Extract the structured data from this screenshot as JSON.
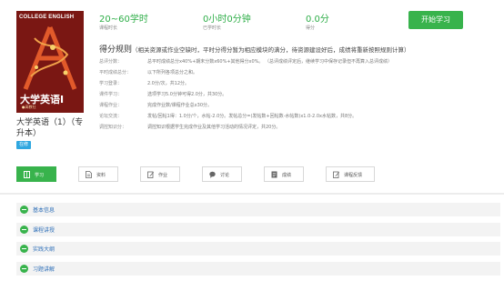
{
  "course": {
    "cover": {
      "caption": "COLLEGE ENGLISH",
      "title": "大学英语Ⅰ",
      "publisher": "●高教社"
    },
    "name": "大学英语（1）（专升本）",
    "badge": "在修"
  },
  "stats": [
    {
      "value": "20~60学时",
      "label": "课程时长"
    },
    {
      "value": "0小时0分钟",
      "label": "已学时长"
    },
    {
      "value": "0.0分",
      "label": "得分"
    }
  ],
  "start_button": "开始学习",
  "rules": {
    "title": "得分规则",
    "desc": "（相关资源或作业空缺时，平时分得分暂为相应模块的满分，待资源建设好后，成绩将重新按照规则计算）",
    "rows": [
      {
        "label": "总评分数：",
        "value": "总平时成绩总分x40%+期末分数x60%+其他得分x0%。  （总评成绩评定后，继续学习中保存记录但不再算入总评成绩）"
      },
      {
        "label": "平时成绩总分：",
        "value": "以下所列各项总分之和。"
      },
      {
        "label": "学习登录：",
        "value": "2.0分/次，共12分。"
      },
      {
        "label": "课件学习：",
        "value": "选项学习5.0分钟可得2.0分，共30分。"
      },
      {
        "label": "课程作业：",
        "value": "完成作业数/课程作业总x30分。"
      },
      {
        "label": "论坛交流：",
        "value": "发帖/回帖1得：1.0分/个，水帖-2.0分。发帖总分=(发帖数+回帖数-水帖数)x1.0-2.0x水帖数，共8分。"
      },
      {
        "label": "调控知识分：",
        "value": "调控知识根据学生完成作业及其他学习活动的情况评定，共20分。"
      }
    ]
  },
  "tabs": [
    {
      "label": "学习",
      "icon": "book-icon"
    },
    {
      "label": "资料",
      "icon": "document-icon"
    },
    {
      "label": "作业",
      "icon": "edit-icon"
    },
    {
      "label": "讨论",
      "icon": "chat-icon"
    },
    {
      "label": "成绩",
      "icon": "report-icon"
    },
    {
      "label": "课程反馈",
      "icon": "feedback-icon"
    }
  ],
  "sections": [
    {
      "label": "基本信息"
    },
    {
      "label": "课程讲授"
    },
    {
      "label": "实践大纲"
    },
    {
      "label": "习题讲解"
    }
  ],
  "colors": {
    "accent": "#38b34c",
    "stat_value": "#2eae48",
    "section_link": "#2e6fb8",
    "badge": "#2fa7e0",
    "cover": "#7a1713"
  }
}
